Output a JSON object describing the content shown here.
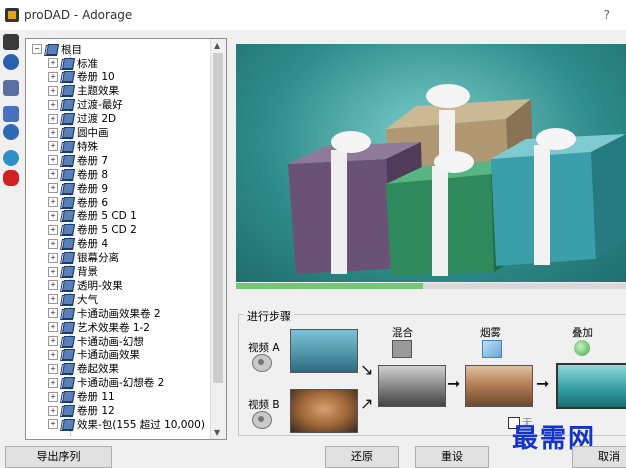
{
  "window": {
    "title": "proDAD - Adorage",
    "help": "?"
  },
  "toolbar": {
    "icons": [
      "film-icon",
      "help-icon",
      "monitor-icon",
      "waveform-icon",
      "record-icon",
      "globe-icon",
      "bug-icon"
    ]
  },
  "tree": {
    "root": "根目",
    "items": [
      "标准",
      "卷册 10",
      "主题效果",
      "过渡-最好",
      "过渡 2D",
      "圆中画",
      "特殊",
      "卷册 7",
      "卷册 8",
      "卷册 9",
      "卷册 6",
      "卷册 5 CD 1",
      "卷册 5 CD 2",
      "卷册 4",
      "银幕分离",
      "背景",
      "透明-效果",
      "大气",
      "卡通动画效果卷 2",
      "艺术效果卷 1-2",
      "卡通动画-幻想",
      "卡通动画效果",
      "卷起效果",
      "卡通动画-幻想卷 2",
      "卷册 11",
      "卷册 12",
      "效果-包(155 超过 10,000)"
    ]
  },
  "preview": {
    "progress": 0.48
  },
  "steps": {
    "title": "进行步骤",
    "video_a": "视频 A",
    "video_b": "视频 B",
    "mix": "混合",
    "fog": "烟雾",
    "overlay": "叠加",
    "checkbox_label": "无"
  },
  "buttons": {
    "export": "导出序列",
    "restore": "还原",
    "reset": "重设",
    "cancel": "取消"
  },
  "watermark": "最需网",
  "colors": {
    "accent": "#1433c8",
    "preview_bg": "#2f8b8b"
  }
}
